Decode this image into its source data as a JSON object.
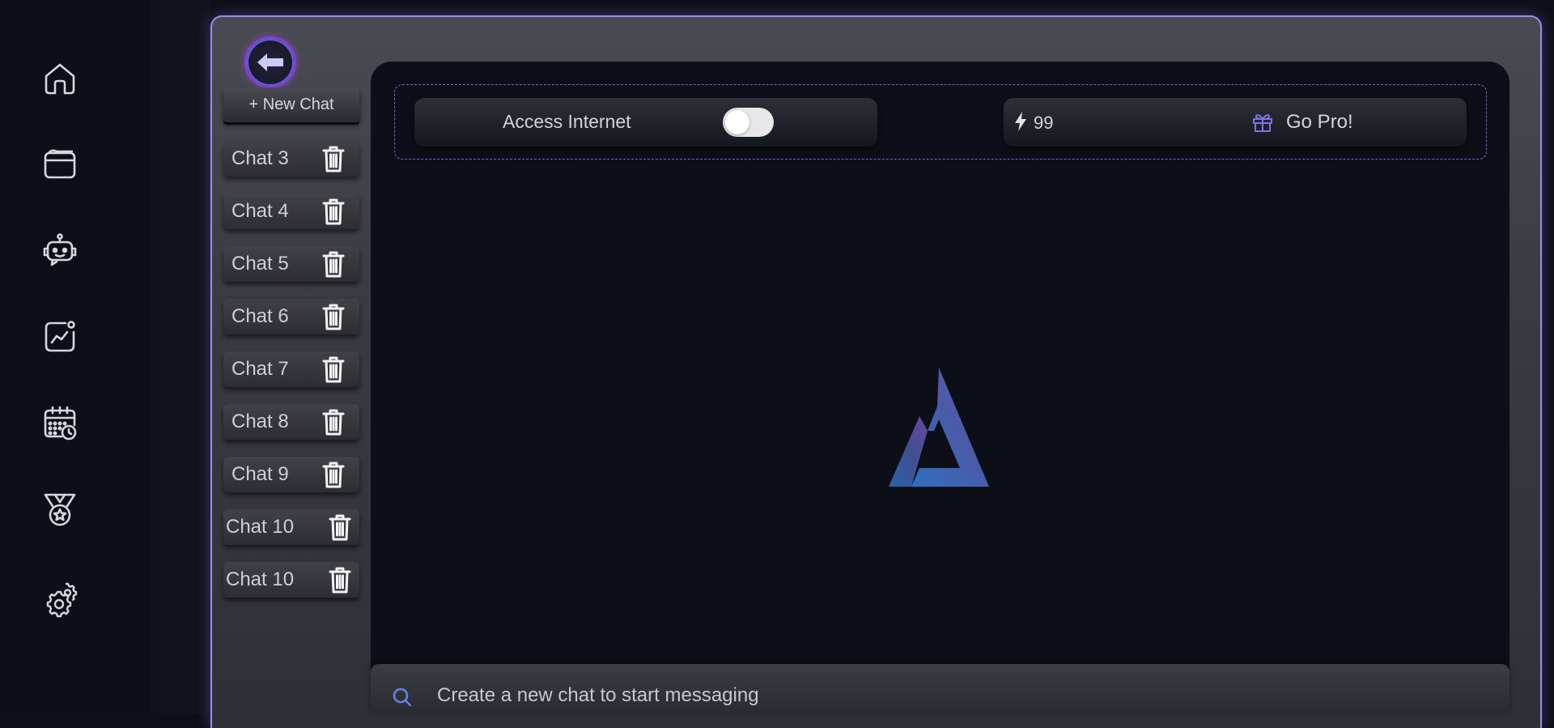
{
  "sidebar": {
    "items": [
      {
        "name": "home-icon"
      },
      {
        "name": "wallet-icon"
      },
      {
        "name": "robot-icon"
      },
      {
        "name": "chart-icon"
      },
      {
        "name": "calendar-icon"
      },
      {
        "name": "medal-icon"
      },
      {
        "name": "gear-icon"
      }
    ]
  },
  "chat_panel": {
    "back_icon": "arrow-left-icon",
    "new_chat_label": "+ New Chat",
    "chats": [
      "Chat 3",
      "Chat 4",
      "Chat 5",
      "Chat 6",
      "Chat 7",
      "Chat 8",
      "Chat 9",
      "Chat 10",
      "Chat 10"
    ]
  },
  "topbar": {
    "access_internet_label": "Access Internet",
    "access_internet_enabled": false,
    "credits": "99",
    "go_pro_label": "Go Pro!"
  },
  "composer": {
    "placeholder": "Create a new chat to start messaging"
  },
  "colors": {
    "accent": "#9d8cf0",
    "background": "#0c0f17",
    "logo_gradient_start": "#2f6fbf",
    "logo_gradient_end": "#7a4fb8"
  }
}
